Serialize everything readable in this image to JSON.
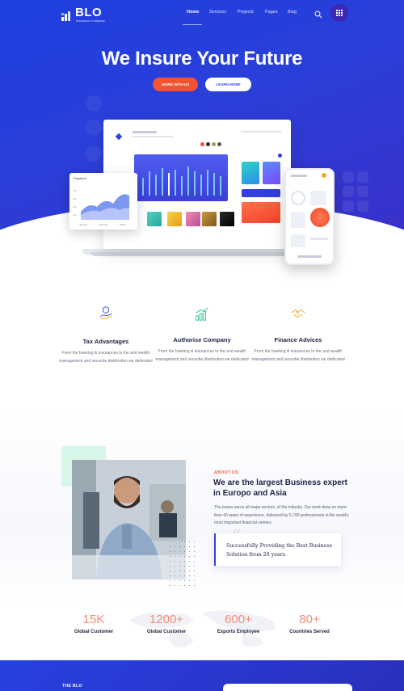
{
  "colors": {
    "hero_blue": "#2a3fd8",
    "accent_orange": "#f5532f",
    "stat_coral": "#f28b78",
    "heading_dark": "#1f2340"
  },
  "brand": {
    "logo_text": "BLO",
    "logo_sub": "Insurance Company"
  },
  "nav": {
    "items": [
      {
        "label": "Home",
        "active": true
      },
      {
        "label": "Services"
      },
      {
        "label": "Projects"
      },
      {
        "label": "Pages"
      },
      {
        "label": "Blog"
      }
    ],
    "search_icon": "search-icon",
    "menu_icon": "grid-menu-icon"
  },
  "hero": {
    "title": "We Insure Your Future",
    "primary_button": "WORK WITH US",
    "secondary_button": "LEARN MORE"
  },
  "mockup": {
    "popup_title": "Payment",
    "popup_axis": [
      "January",
      "February",
      "March"
    ],
    "popup_y": [
      "400",
      "300",
      "200",
      "100"
    ]
  },
  "features": [
    {
      "icon": "hand-coin-icon",
      "title": "Tax Advantages",
      "text": "From the banking & insurances to the and wealth management and securitie distribution we dedicated"
    },
    {
      "icon": "growth-chart-icon",
      "title": "Authorise Company",
      "text": "From the banking & insurances to the and wealth management and securitie distribution we dedicated"
    },
    {
      "icon": "handshake-icon",
      "title": "Finance Advices",
      "text": "From the banking & insurances to the and wealth management and securitie distribution we dedicated"
    }
  ],
  "about": {
    "label": "ABOUT US",
    "title": "We are the largest Business expert in Europo and Asia",
    "text": "The teams serve all major sectors, of the industry. Our work draw on more than 40 years of experience, delivered by 5,700 professionals in the world's most important financial centers.",
    "quote": "Successfully Providing the Best Business Solution from 20 years"
  },
  "stats": [
    {
      "value": "15K",
      "label": "Global Customer"
    },
    {
      "value": "1200+",
      "label": "Global Customer"
    },
    {
      "value": "600+",
      "label": "Exports Employee"
    },
    {
      "value": "80+",
      "label": "Countries Served"
    }
  ],
  "bottom": {
    "label": "THE BLO"
  }
}
